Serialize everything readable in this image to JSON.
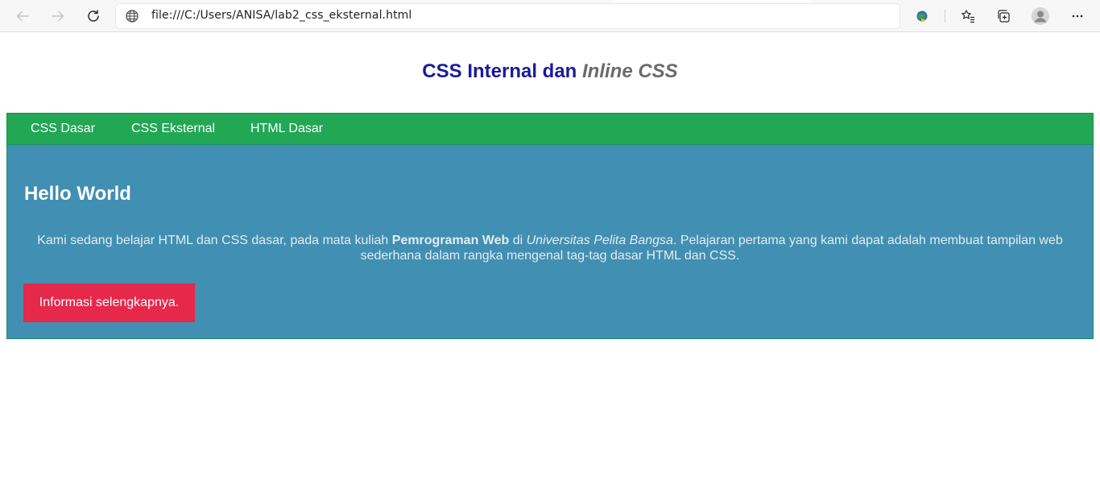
{
  "browser": {
    "address": "file:///C:/Users/ANISA/lab2_css_eksternal.html",
    "icons": [
      "back-arrow-icon",
      "forward-arrow-icon",
      "reload-icon",
      "globe-icon",
      "extension-icon",
      "favorites-icon",
      "collections-icon",
      "profile-avatar-icon",
      "more-options-icon"
    ]
  },
  "page": {
    "title_main": "CSS Internal dan ",
    "title_em": "Inline CSS",
    "nav": [
      {
        "label": "CSS Dasar"
      },
      {
        "label": "CSS Eksternal"
      },
      {
        "label": "HTML Dasar"
      }
    ],
    "heading": "Hello World",
    "paragraph": {
      "part1": "Kami sedang belajar HTML dan CSS dasar, pada mata kuliah ",
      "bold": "Pemrograman Web",
      "part2": " di ",
      "italic": "Universitas Pelita Bangsa",
      "part3": ". Pelajaran pertama yang kami dapat adalah membuat tampilan web sederhana dalam rangka mengenal tag-tag dasar HTML dan CSS."
    },
    "button_label": "Informasi selengkapnya."
  },
  "colors": {
    "title": "#1a1a9c",
    "title_em": "#6b6b6b",
    "navbar": "#22a754",
    "content_bg": "#418fb2",
    "button_bg": "#e6284a"
  }
}
